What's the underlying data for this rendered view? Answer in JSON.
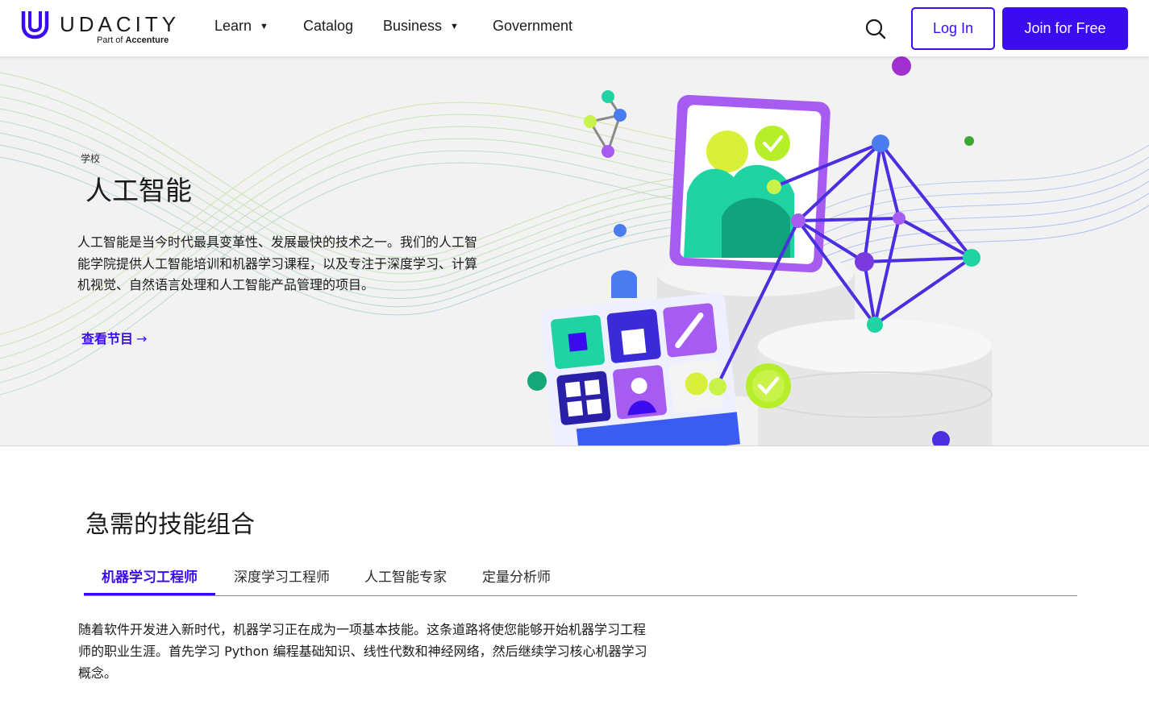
{
  "header": {
    "logo_word": "UDACITY",
    "logo_sub_prefix": "Part of ",
    "logo_sub_brand": "Accenture",
    "nav": [
      {
        "label": "Learn",
        "has_menu": true
      },
      {
        "label": "Catalog",
        "has_menu": false
      },
      {
        "label": "Business",
        "has_menu": true
      },
      {
        "label": "Government",
        "has_menu": false
      }
    ],
    "caret": "▼",
    "search_icon": "search-icon",
    "login_label": "Log In",
    "join_label": "Join for Free"
  },
  "hero": {
    "eyebrow": "学校",
    "title": "人工智能",
    "description": "人工智能是当今时代最具变革性、发展最快的技术之一。我们的人工智能学院提供人工智能培训和机器学习课程，以及专注于深度学习、计算机视觉、自然语言处理和人工智能产品管理的项目。",
    "link_label": "查看节目",
    "link_arrow": "→"
  },
  "skills": {
    "title": "急需的技能组合",
    "tabs": [
      {
        "label": "机器学习工程师",
        "active": true
      },
      {
        "label": "深度学习工程师",
        "active": false
      },
      {
        "label": "人工智能专家",
        "active": false
      },
      {
        "label": "定量分析师",
        "active": false
      }
    ],
    "description": "随着软件开发进入新时代，机器学习正在成为一项基本技能。这条道路将使您能够开始机器学习工程师的职业生涯。首先学习 Python 编程基础知识、线性代数和神经网络，然后继续学习核心机器学习概念。"
  },
  "colors": {
    "accent": "#3b0cf0",
    "hero_bg": "#f2f2f2",
    "text": "#1b1b1b"
  }
}
